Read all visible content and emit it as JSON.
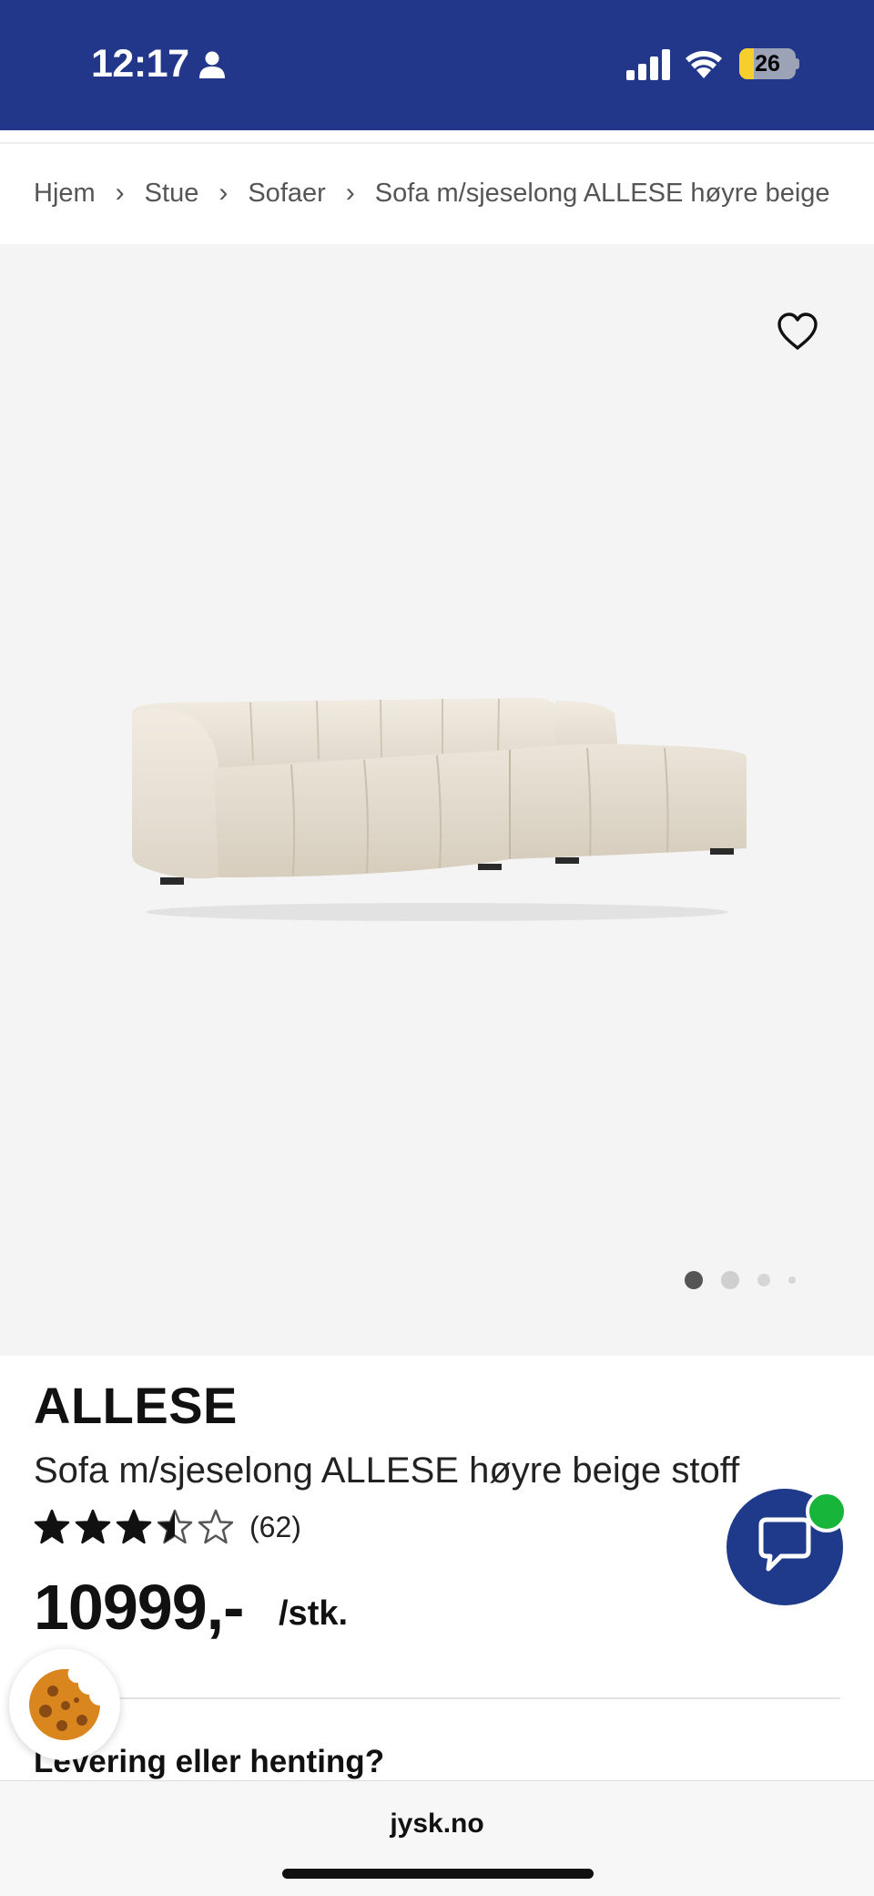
{
  "status_bar": {
    "time": "12:17",
    "battery_level": "26",
    "icons": [
      "person-icon",
      "signal-icon",
      "wifi-icon",
      "battery-icon"
    ],
    "background_color": "#22378a"
  },
  "breadcrumb": {
    "items": [
      "Hjem",
      "Stue",
      "Sofaer",
      "Sofa m/sjeselong ALLESE høyre beige"
    ],
    "separator": "›"
  },
  "gallery": {
    "image_subject": "beige chaise-longue sofa",
    "current_image": 1,
    "total_images": 4,
    "wishlist_icon": "heart-icon"
  },
  "product": {
    "brand": "ALLESE",
    "name": "Sofa m/sjeselong ALLESE høyre beige stoff",
    "rating": 3.5,
    "rating_max": 5,
    "review_count": "(62)",
    "price": "10999,-",
    "unit": "/stk."
  },
  "delivery": {
    "heading": "Levering eller henting?"
  },
  "floating": {
    "chat_icon": "chat-bubble-icon",
    "chat_color": "#1f3a8a",
    "chat_badge_color": "#17b63a",
    "cookie_icon": "cookie-icon"
  },
  "browser": {
    "url": "jysk.no"
  }
}
